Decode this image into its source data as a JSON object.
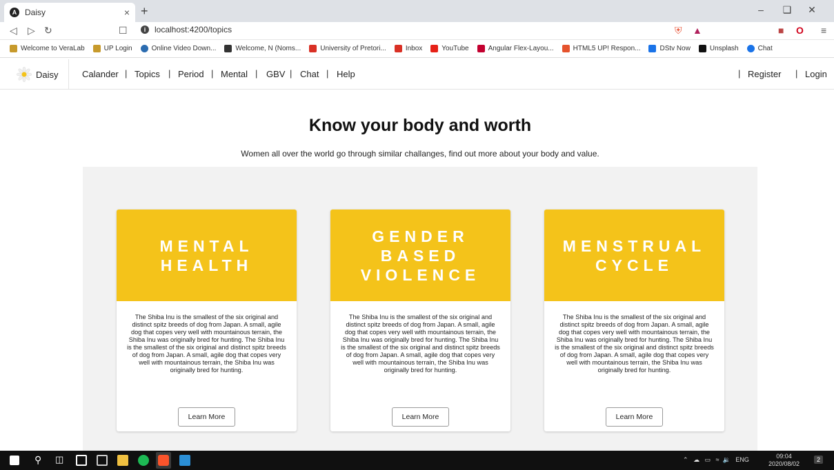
{
  "browser": {
    "tab_title": "Daisy",
    "tab_close": "×",
    "new_tab": "+",
    "url": "localhost:4200/topics",
    "bookmarks": [
      {
        "label": "Welcome to VeraLab",
        "color": "#c79a2c"
      },
      {
        "label": "UP Login",
        "color": "#c79a2c"
      },
      {
        "label": "Online Video Down...",
        "color": "#2b6cb0"
      },
      {
        "label": "Welcome, N (Noms...",
        "color": "#333333"
      },
      {
        "label": "University of Pretori...",
        "color": "#d93025"
      },
      {
        "label": "Inbox",
        "color": "#d93025"
      },
      {
        "label": "YouTube",
        "color": "#e62117"
      },
      {
        "label": "Angular Flex-Layou...",
        "color": "#c3002f"
      },
      {
        "label": "HTML5 UP! Respon...",
        "color": "#e5532d"
      },
      {
        "label": "DStv Now",
        "color": "#1a73e8"
      },
      {
        "label": "Unsplash",
        "color": "#111111"
      },
      {
        "label": "Chat",
        "color": "#1a73e8"
      }
    ]
  },
  "nav": {
    "brand": "Daisy",
    "links": [
      "Calander",
      "Topics",
      "Period",
      "Mental",
      "GBV",
      "Chat",
      "Help"
    ],
    "register": "Register",
    "login": "Login",
    "separator": "|"
  },
  "hero": {
    "title": "Know your body and worth",
    "subtitle": "Women all over the world go through similar challanges, find out more about your body and value."
  },
  "cards": [
    {
      "banner": "MENTAL\nHEALTH",
      "description": "The Shiba Inu is the smallest of the six original and distinct spitz breeds of dog from Japan. A small, agile dog that copes very well with mountainous terrain, the Shiba Inu was originally bred for hunting. The Shiba Inu is the smallest of the six original and distinct spitz breeds of dog from Japan. A small, agile dog that copes very well with mountainous terrain, the Shiba Inu was originally bred for hunting.",
      "button": "Learn More"
    },
    {
      "banner": "GENDER\nBASED\nVIOLENCE",
      "description": "The Shiba Inu is the smallest of the six original and distinct spitz breeds of dog from Japan. A small, agile dog that copes very well with mountainous terrain, the Shiba Inu was originally bred for hunting. The Shiba Inu is the smallest of the six original and distinct spitz breeds of dog from Japan. A small, agile dog that copes very well with mountainous terrain, the Shiba Inu was originally bred for hunting.",
      "button": "Learn More"
    },
    {
      "banner": "MENSTRUAL\nCYCLE",
      "description": "The Shiba Inu is the smallest of the six original and distinct spitz breeds of dog from Japan. A small, agile dog that copes very well with mountainous terrain, the Shiba Inu was originally bred for hunting. The Shiba Inu is the smallest of the six original and distinct spitz breeds of dog from Japan. A small, agile dog that copes very well with mountainous terrain, the Shiba Inu was originally bred for hunting.",
      "button": "Learn More"
    }
  ],
  "colors": {
    "banner": "#f4c31a",
    "panel": "#f2f2f2"
  },
  "taskbar": {
    "language": "ENG",
    "time": "09:04",
    "date": "2020/08/02",
    "notifications": "2"
  }
}
